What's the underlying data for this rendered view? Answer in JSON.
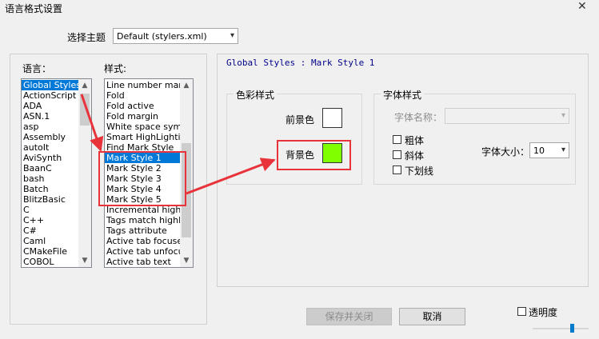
{
  "window": {
    "title": "语言格式设置",
    "close_label": "✕"
  },
  "theme": {
    "label": "选择主题",
    "value": "Default (stylers.xml)"
  },
  "languages": {
    "label": "语言：",
    "items": [
      "Global Styles",
      "ActionScript",
      "ADA",
      "ASN.1",
      "asp",
      "Assembly",
      "autoIt",
      "AviSynth",
      "BaanC",
      "bash",
      "Batch",
      "BlitzBasic",
      "C",
      "C++",
      "C#",
      "Caml",
      "CMakeFile",
      "COBOL"
    ],
    "selected_index": 0
  },
  "styles": {
    "label": "样式:",
    "items": [
      "Line number margin",
      "Fold",
      "Fold active",
      "Fold margin",
      "White space symbol",
      "Smart HighLighting",
      "Find Mark Style",
      "Mark Style 1",
      "Mark Style 2",
      "Mark Style 3",
      "Mark Style 4",
      "Mark Style 5",
      "Incremental highlight",
      "Tags match highlight",
      "Tags attribute",
      "Active tab focused",
      "Active tab unfocused",
      "Active tab text"
    ],
    "selected_index": 7
  },
  "header": {
    "text": "Global Styles : Mark Style 1"
  },
  "color_group": {
    "title": "色彩样式",
    "fg_label": "前景色",
    "bg_label": "背景色",
    "fg_color": "#ffffff",
    "bg_color": "#80ff00"
  },
  "font_group": {
    "title": "字体样式",
    "name_label": "字体名称：",
    "name_value": "",
    "bold_label": "粗体",
    "italic_label": "斜体",
    "underline_label": "下划线",
    "size_label": "字体大小：",
    "size_value": "10"
  },
  "buttons": {
    "save_close": "保存并关闭",
    "cancel": "取消"
  },
  "transparency": {
    "label": "透明度"
  },
  "colors": {
    "selection": "#0078d7",
    "annotation": "#e8333a"
  }
}
